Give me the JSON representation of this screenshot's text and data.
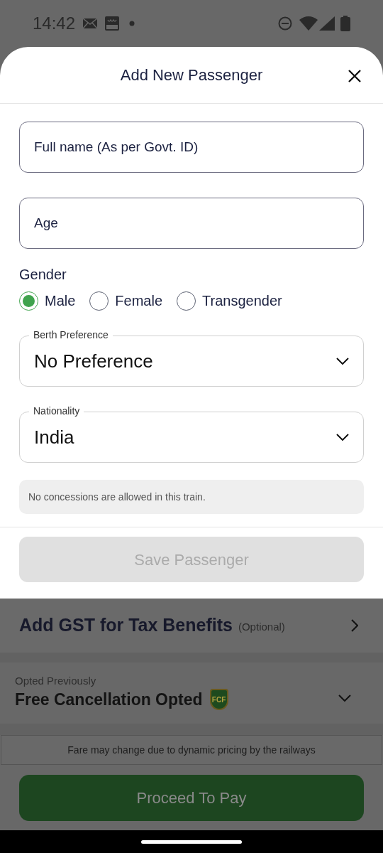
{
  "status_bar": {
    "time": "14:42"
  },
  "sheet": {
    "title": "Add New Passenger",
    "fields": [
      {
        "kind": "text",
        "placeholder": "Full name (As per Govt. ID)"
      },
      {
        "kind": "text",
        "placeholder": "Age"
      }
    ],
    "gender": {
      "label": "Gender",
      "options": [
        {
          "label": "Male",
          "selected": true
        },
        {
          "label": "Female",
          "selected": false
        },
        {
          "label": "Transgender",
          "selected": false
        }
      ]
    },
    "dropdowns": [
      {
        "label": "Berth Preference",
        "value": "No Preference"
      },
      {
        "label": "Nationality",
        "value": "India"
      }
    ],
    "note": "No concessions are allowed in this train.",
    "save_button": {
      "label": "Save Passenger",
      "disabled": true
    }
  },
  "background": {
    "gst": {
      "title": "Add GST for Tax Benefits",
      "optional": "(Optional)"
    },
    "cancellation": {
      "caption": "Opted Previously",
      "title": "Free Cancellation Opted",
      "badge": "FCF"
    },
    "fare_note": "Fare may change due to dynamic pricing by the railways",
    "proceed_button": {
      "label": "Proceed To Pay"
    }
  }
}
